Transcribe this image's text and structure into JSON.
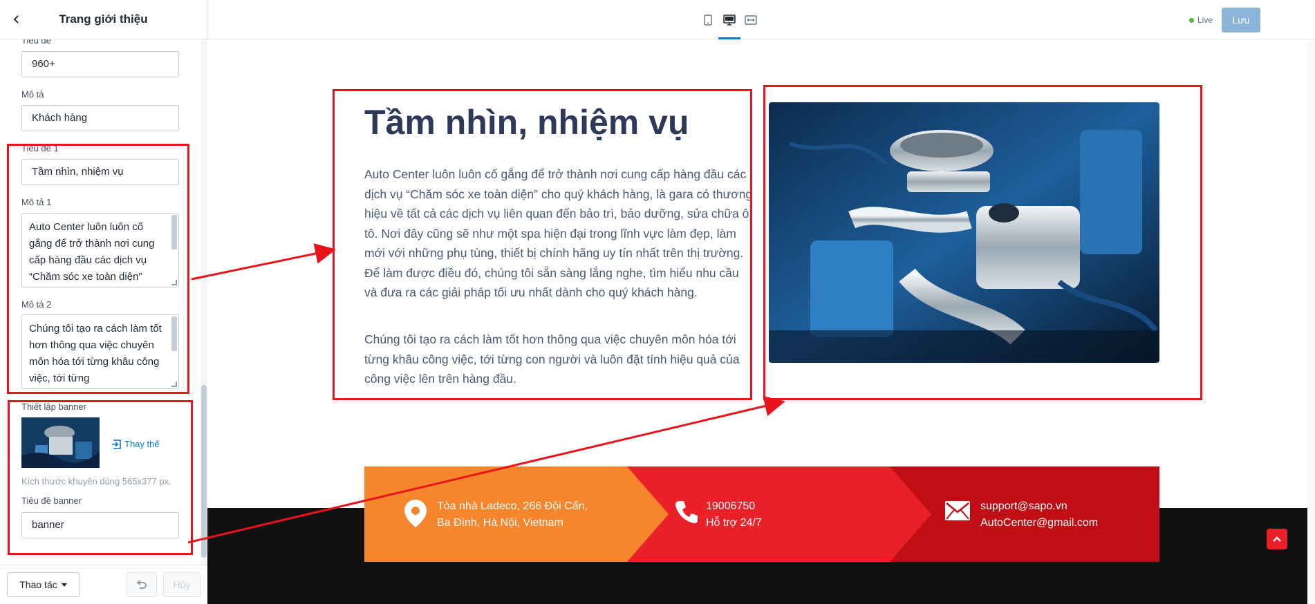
{
  "sidebar": {
    "title": "Trang giới thiệu",
    "fields": {
      "title_label": "Tiêu đề",
      "title_value": "960+",
      "desc_label": "Mô tả",
      "desc_value": "Khách hàng",
      "title1_label": "Tiêu đề 1",
      "title1_value": "Tầm nhìn, nhiệm vụ",
      "desc1_label": "Mô tả 1",
      "desc1_value": "Auto Center luôn luôn cố gắng để trở thành nơi cung cấp hàng đầu các dịch vụ “Chăm sóc xe toàn diện”",
      "desc2_label": "Mô tả 2",
      "desc2_value": "Chúng tôi tạo ra cách làm tốt hơn thông qua việc chuyên môn hóa tới từng khâu công việc, tới từng",
      "banner_label": "Thiết lập banner",
      "banner_replace": "Thay thế",
      "banner_hint": "Kích thước khuyên dùng 565x377 px.",
      "banner_title_label": "Tiêu đề banner",
      "banner_title_value": "banner"
    },
    "footer": {
      "action_label": "Thao tác",
      "cancel_label": "Hủy"
    }
  },
  "topbar": {
    "devices": [
      "mobile-icon",
      "desktop-icon",
      "fullwidth-icon"
    ],
    "active_device": "desktop-icon",
    "live_label": "Live",
    "save_label": "Lưu"
  },
  "content": {
    "heading": "Tầm nhìn, nhiệm vụ",
    "paragraph1": "Auto Center luôn luôn cố gắng để trở thành nơi cung cấp hàng đầu các dịch vụ “Chăm sóc xe toàn diện” cho quý khách hàng, là gara có thương hiệu về tất cả các dịch vụ liên quan đến bảo trì, bảo dưỡng, sửa chữa ô tô. Nơi đây cũng sẽ như một spa hiện đại trong lĩnh vực làm đẹp, làm mới với những phụ tùng, thiết bị chính hãng uy tín nhất trên thị trường. Để làm được điều đó, chúng tôi sẵn sàng lắng nghe, tìm hiểu nhu cầu và đưa ra các giải pháp tối ưu nhất dành cho quý khách hàng.",
    "paragraph2": "Chúng tôi tạo ra cách làm tốt hơn thông qua việc chuyên môn hóa tới từng khâu công việc, tới từng con người và luôn đặt tính hiệu quả của công việc lên trên hàng đầu."
  },
  "contact_band": {
    "address_line1": "Tòa nhà Ladeco, 266 Đội Cấn,",
    "address_line2": "Ba Đình, Hà Nội, Vietnam",
    "phone_line1": "19006750",
    "phone_line2": "Hỗ trợ 24/7",
    "email_line1": "support@sapo.vn",
    "email_line2": "AutoCenter@gmail.com",
    "colors": [
      "#f7852c",
      "#e92027",
      "#c10d14"
    ]
  },
  "annotation_color": "#e8131b"
}
